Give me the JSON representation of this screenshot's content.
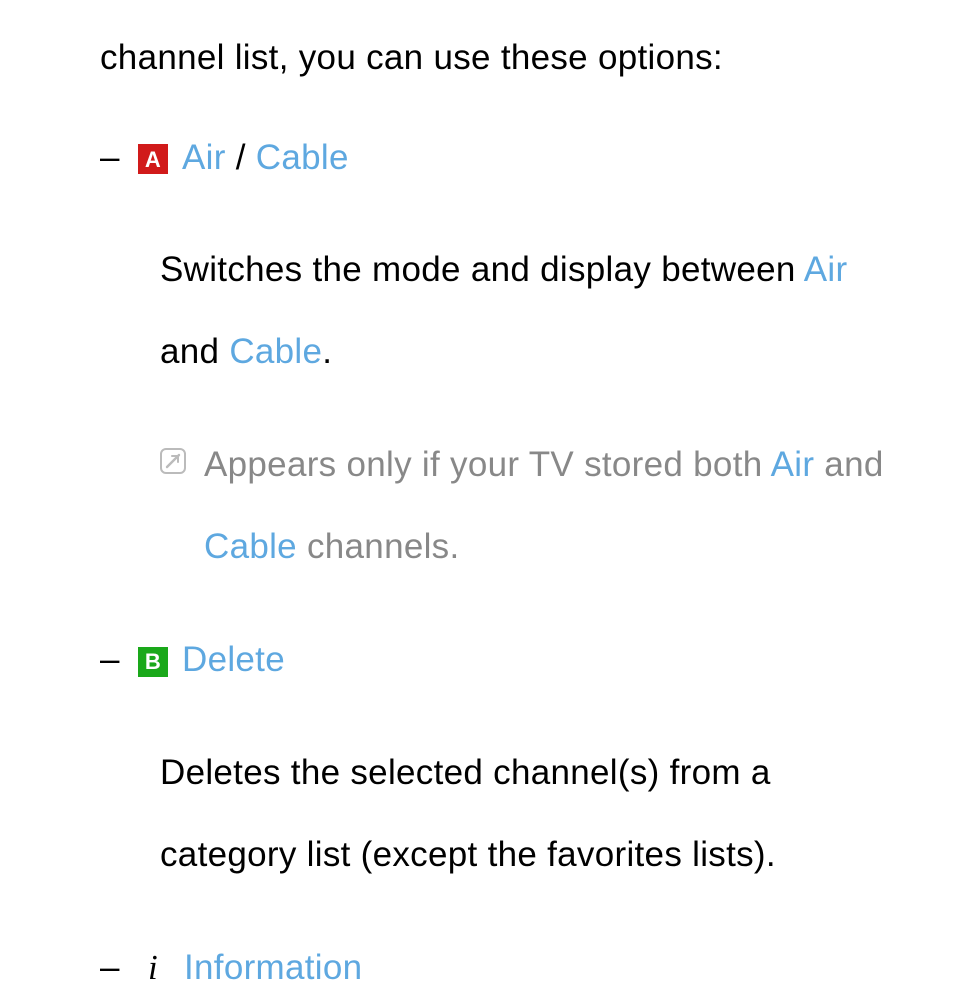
{
  "intro": "channel list, you can use these options:",
  "items": [
    {
      "badge": "a",
      "title_parts": {
        "air": "Air",
        "slash": " / ",
        "cable": "Cable"
      },
      "body": {
        "part1": "Switches the mode and display between ",
        "air": "Air",
        "part2": " and ",
        "cable": "Cable",
        "part3": "."
      },
      "note": {
        "part1": "Appears only if your TV stored both ",
        "air": "Air",
        "part2": " and ",
        "cable": "Cable",
        "part3": " channels."
      }
    },
    {
      "badge": "b",
      "title": "Delete",
      "body": "Deletes the selected channel(s) from a category list (except the favorites lists)."
    },
    {
      "icon": "i",
      "title": "Information"
    }
  ],
  "badges": {
    "a": "A",
    "b": "B"
  }
}
